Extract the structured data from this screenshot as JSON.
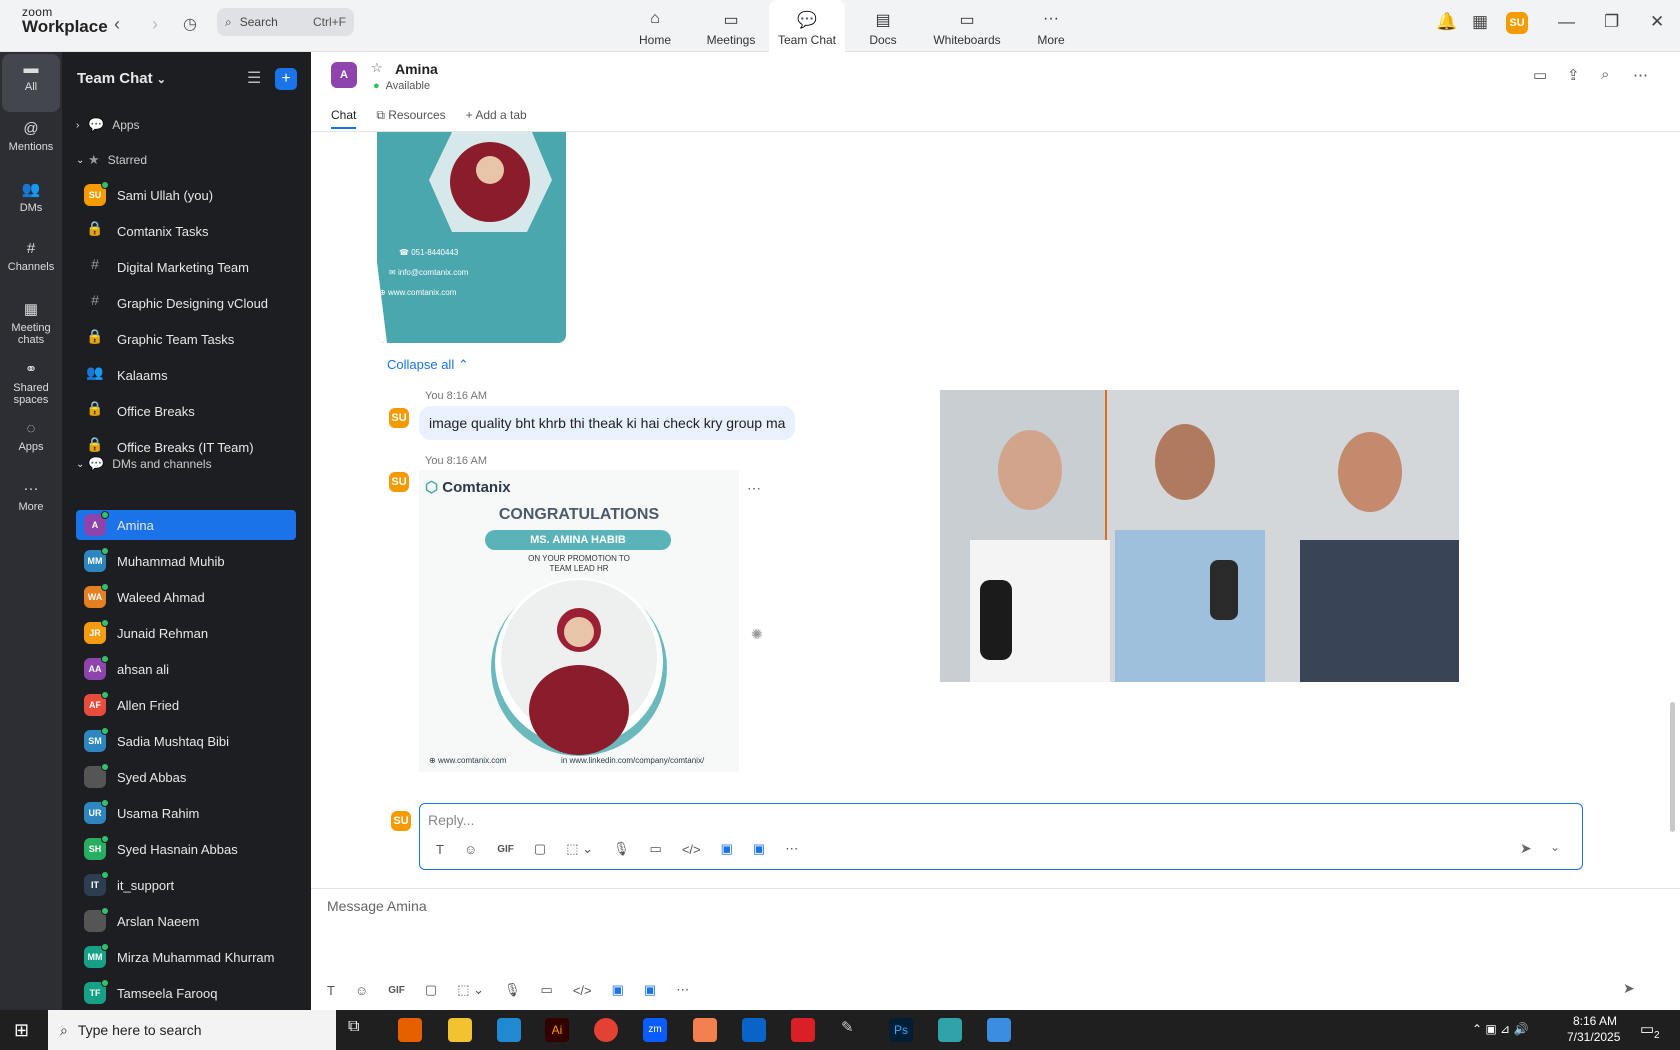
{
  "window": {
    "brand_small": "zoom",
    "brand_large": "Workplace"
  },
  "search": {
    "label": "Search",
    "shortcut": "Ctrl+F"
  },
  "nav_tabs": [
    {
      "label": "Home",
      "icon": "home-icon"
    },
    {
      "label": "Meetings",
      "icon": "video-icon"
    },
    {
      "label": "Team Chat",
      "icon": "chat-icon"
    },
    {
      "label": "Docs",
      "icon": "doc-icon"
    },
    {
      "label": "Whiteboards",
      "icon": "whiteboard-icon"
    },
    {
      "label": "More",
      "icon": "more-icon"
    }
  ],
  "user_avatar": {
    "initials": "SU",
    "color": "#f59b00"
  },
  "rail": [
    {
      "label": "All"
    },
    {
      "label": "Mentions"
    },
    {
      "label": "DMs"
    },
    {
      "label": "Channels"
    },
    {
      "label": "Meeting chats"
    },
    {
      "label": "Shared spaces"
    },
    {
      "label": "Apps"
    },
    {
      "label": "More"
    }
  ],
  "sidebar": {
    "title": "Team Chat",
    "sections": {
      "apps": "Apps",
      "starred": "Starred",
      "dms": "DMs and channels"
    },
    "starred": [
      {
        "label": "Sami Ullah (you)",
        "initials": "SU",
        "color": "#f59b00"
      },
      {
        "label": "Comtanix Tasks",
        "glyph": "🔒"
      },
      {
        "label": "Digital Marketing Team",
        "glyph": "#"
      },
      {
        "label": "Graphic Designing vCloud",
        "glyph": "#"
      },
      {
        "label": "Graphic Team Tasks",
        "glyph": "🔒"
      },
      {
        "label": "Kalaams",
        "glyph": "👥"
      },
      {
        "label": "Office Breaks",
        "glyph": "🔒"
      },
      {
        "label": "Office Breaks (IT Team)",
        "glyph": "🔒"
      }
    ],
    "dms": [
      {
        "label": "Amina",
        "initials": "A",
        "color": "#8e44ad"
      },
      {
        "label": "Muhammad Muhib",
        "initials": "MM",
        "color": "#2e86c1"
      },
      {
        "label": "Waleed Ahmad",
        "initials": "WA",
        "color": "#e67e22"
      },
      {
        "label": "Junaid Rehman",
        "initials": "JR",
        "color": "#f39c12"
      },
      {
        "label": "ahsan ali",
        "initials": "AA",
        "color": "#8e44ad"
      },
      {
        "label": "Allen Fried",
        "initials": "AF",
        "color": "#e74c3c"
      },
      {
        "label": "Sadia Mushtaq Bibi",
        "initials": "SM",
        "color": "#2e86c1"
      },
      {
        "label": "Syed Abbas",
        "initials": "",
        "color": "#555"
      },
      {
        "label": "Usama Rahim",
        "initials": "UR",
        "color": "#2e86c1"
      },
      {
        "label": "Syed Hasnain Abbas",
        "initials": "SH",
        "color": "#27ae60"
      },
      {
        "label": "it_support",
        "initials": "IT",
        "color": "#2c3e50"
      },
      {
        "label": "Arslan Naeem",
        "initials": "",
        "color": "#555"
      },
      {
        "label": "Mirza Muhammad Khurram",
        "initials": "MM",
        "color": "#16a085"
      },
      {
        "label": "Tamseela Farooq",
        "initials": "TF",
        "color": "#16a085"
      }
    ]
  },
  "chat": {
    "name": "Amina",
    "status": "Available",
    "initials": "A",
    "color": "#8e44ad",
    "tabs": {
      "chat": "Chat",
      "resources": "Resources",
      "add": "Add a tab"
    },
    "card": {
      "phone": "051-8440443",
      "email": "info@comtanix.com",
      "web": "www.comtanix.com"
    },
    "collapse": "Collapse all",
    "messages": [
      {
        "meta": "You 8:16 AM",
        "text": "image quality bht khrb thi theak ki hai check kry group ma"
      },
      {
        "meta": "You 8:16 AM"
      }
    ],
    "poster": {
      "brand": "Comtanix",
      "headline": "CONGRATULATIONS",
      "name": "MS. AMINA HABIB",
      "sub1": "ON YOUR PROMOTION TO",
      "sub2": "TEAM LEAD HR",
      "web": "www.comtanix.com",
      "linkedin": "www.linkedin.com/company/comtanix/"
    },
    "reply_placeholder": "Reply...",
    "compose_placeholder": "Message Amina"
  },
  "taskbar": {
    "search": "Type here to search",
    "time": "8:16 AM",
    "date": "7/31/2025",
    "badge": "2"
  }
}
